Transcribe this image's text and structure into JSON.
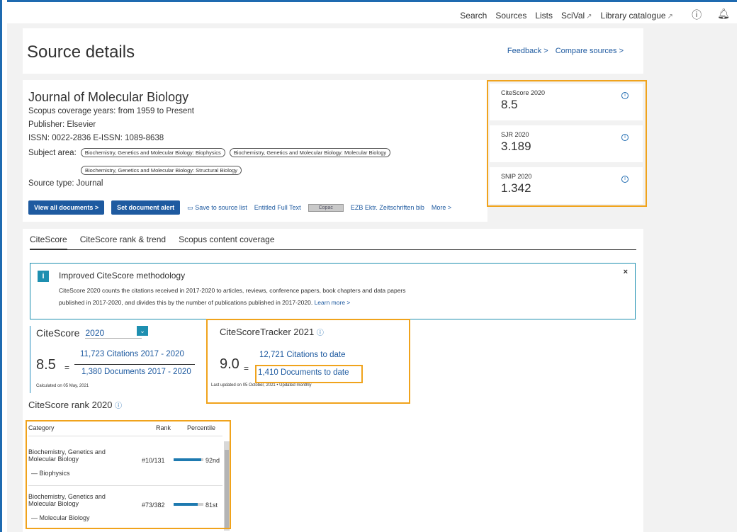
{
  "topnav": {
    "links": [
      "Search",
      "Sources",
      "Lists",
      "SciVal",
      "Library catalogue"
    ],
    "ext_mark": "↗"
  },
  "header": {
    "title": "Source details",
    "feedback": "Feedback",
    "compare": "Compare sources"
  },
  "journal": {
    "title": "Journal of Molecular Biology",
    "coverage": "Scopus coverage years:  from 1959 to Present",
    "publisher": "Publisher:  Elsevier",
    "issn": "ISSN:  0022-2836  E-ISSN:  1089-8638",
    "subject_label": "Subject area:",
    "subjects": [
      "Biochemistry, Genetics and Molecular Biology: Biophysics",
      "Biochemistry, Genetics and Molecular Biology: Molecular Biology",
      "Biochemistry, Genetics and Molecular Biology: Structural Biology"
    ],
    "source_type": "Source type:  Journal"
  },
  "actions": {
    "view_all": "View all documents >",
    "set_alert": "Set document alert",
    "save": "Save to source list",
    "full_text": "Entitled Full Text",
    "copac": "Copac",
    "ezb": "EZB Ektr. Zeitschriften bib",
    "more": "More >"
  },
  "metrics": [
    {
      "label": "CiteScore 2020",
      "value": "8.5"
    },
    {
      "label": "SJR 2020",
      "value": "3.189"
    },
    {
      "label": "SNIP 2020",
      "value": "1.342"
    }
  ],
  "tabs": [
    "CiteScore",
    "CiteScore rank & trend",
    "Scopus content coverage"
  ],
  "notice": {
    "icon": "i",
    "title": "Improved CiteScore methodology",
    "text": "CiteScore 2020 counts the citations received in 2017-2020 to articles, reviews, conference papers, book chapters and data papers published in 2017-2020, and divides this by the number of publications published in 2017-2020.",
    "learn_more": "Learn more >",
    "close": "×"
  },
  "citescore": {
    "title": "CiteScore",
    "year": "2020",
    "value": "8.5",
    "citations": "11,723 Citations 2017 - 2020",
    "documents": "1,380 Documents 2017 - 2020",
    "calc_note": "Calculated on 05 May, 2021"
  },
  "tracker": {
    "title": "CiteScoreTracker 2021",
    "value": "9.0",
    "citations": "12,721 Citations to date",
    "documents": "1,410 Documents to date",
    "note": "Last updated on 05 October, 2021 • Updated monthly"
  },
  "rank": {
    "title": "CiteScore rank 2020",
    "headers": {
      "category": "Category",
      "rank": "Rank",
      "percentile": "Percentile"
    },
    "rows": [
      {
        "category": "Biochemistry, Genetics and Molecular Biology",
        "sub": "Biophysics",
        "rank": "#10/131",
        "percentile_label": "92nd",
        "percentile": 92
      },
      {
        "category": "Biochemistry, Genetics and Molecular Biology",
        "sub": "Molecular Biology",
        "rank": "#73/382",
        "percentile_label": "81st",
        "percentile": 81
      }
    ]
  },
  "colors": {
    "accent": "#1e5aa0",
    "highlight": "#f0a31c",
    "info": "#1e8fb0"
  }
}
